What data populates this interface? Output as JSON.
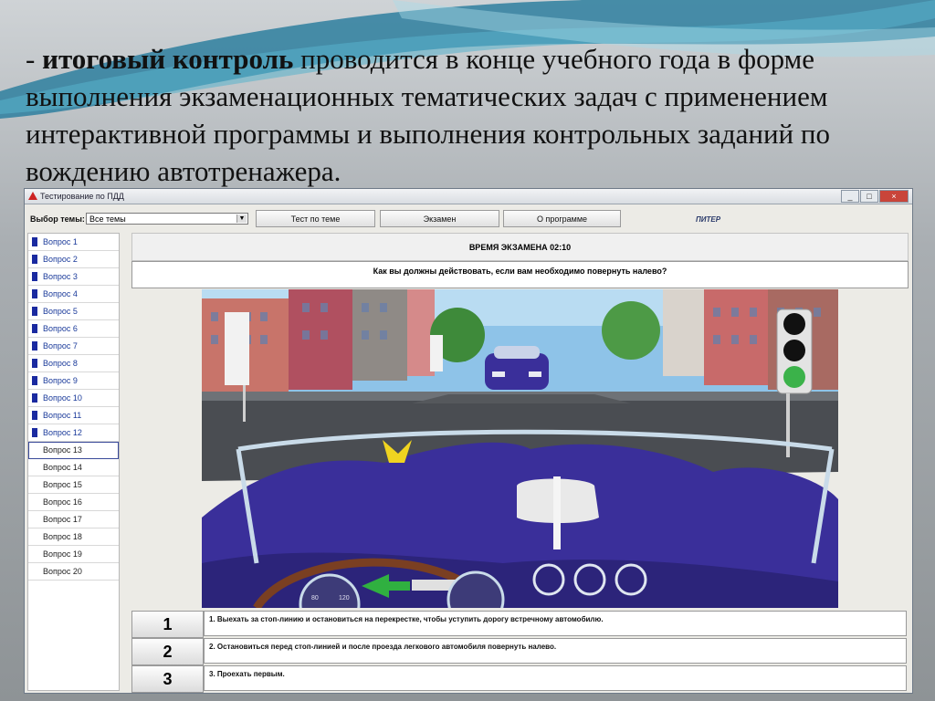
{
  "slide": {
    "dash": "- ",
    "bold": "итоговый контроль",
    "rest": " проводится в конце учебного года в форме выполнения экзаменационных тематических задач с применением интерактивной программы и выполнения контрольных заданий по вождению автотренажера."
  },
  "window": {
    "title": "Тестирование по ПДД",
    "minimize": "_",
    "maximize": "□",
    "close": "×"
  },
  "toolbar": {
    "topic_label": "Выбор темы:",
    "topic_value": "Все темы",
    "test_button": "Тест по теме",
    "exam_button": "Экзамен",
    "about_button": "О программе",
    "logo": "ПИТЕР"
  },
  "sidebar": {
    "items": [
      {
        "label": "Вопрос 1",
        "answered": true
      },
      {
        "label": "Вопрос 2",
        "answered": true
      },
      {
        "label": "Вопрос 3",
        "answered": true
      },
      {
        "label": "Вопрос 4",
        "answered": true
      },
      {
        "label": "Вопрос 5",
        "answered": true
      },
      {
        "label": "Вопрос 6",
        "answered": true
      },
      {
        "label": "Вопрос 7",
        "answered": true
      },
      {
        "label": "Вопрос 8",
        "answered": true
      },
      {
        "label": "Вопрос 9",
        "answered": true
      },
      {
        "label": "Вопрос 10",
        "answered": true
      },
      {
        "label": "Вопрос 11",
        "answered": true
      },
      {
        "label": "Вопрос 12",
        "answered": true
      },
      {
        "label": "Вопрос 13",
        "answered": false,
        "selected": true
      },
      {
        "label": "Вопрос 14",
        "answered": false
      },
      {
        "label": "Вопрос 15",
        "answered": false
      },
      {
        "label": "Вопрос 16",
        "answered": false
      },
      {
        "label": "Вопрос 17",
        "answered": false
      },
      {
        "label": "Вопрос 18",
        "answered": false
      },
      {
        "label": "Вопрос 19",
        "answered": false
      },
      {
        "label": "Вопрос 20",
        "answered": false
      }
    ]
  },
  "exam": {
    "timer": "ВРЕМЯ ЭКЗАМЕНА 02:10",
    "question": "Как вы должны действовать, если вам необходимо повернуть налево?",
    "answers": [
      {
        "num": "1",
        "text": "1. Выехать за стоп-линию и остановиться на перекрестке, чтобы уступить дорогу встречному автомобилю."
      },
      {
        "num": "2",
        "text": "2. Остановиться перед стоп-линией и после проезда легкового автомобиля повернуть налево."
      },
      {
        "num": "3",
        "text": "3. Проехать первым."
      }
    ],
    "gauge_labels": [
      "80",
      "120"
    ]
  },
  "colors": {
    "marker": "#1a2aa0",
    "car_body": "#3a2f9a",
    "signal_green": "#3bb24a"
  }
}
